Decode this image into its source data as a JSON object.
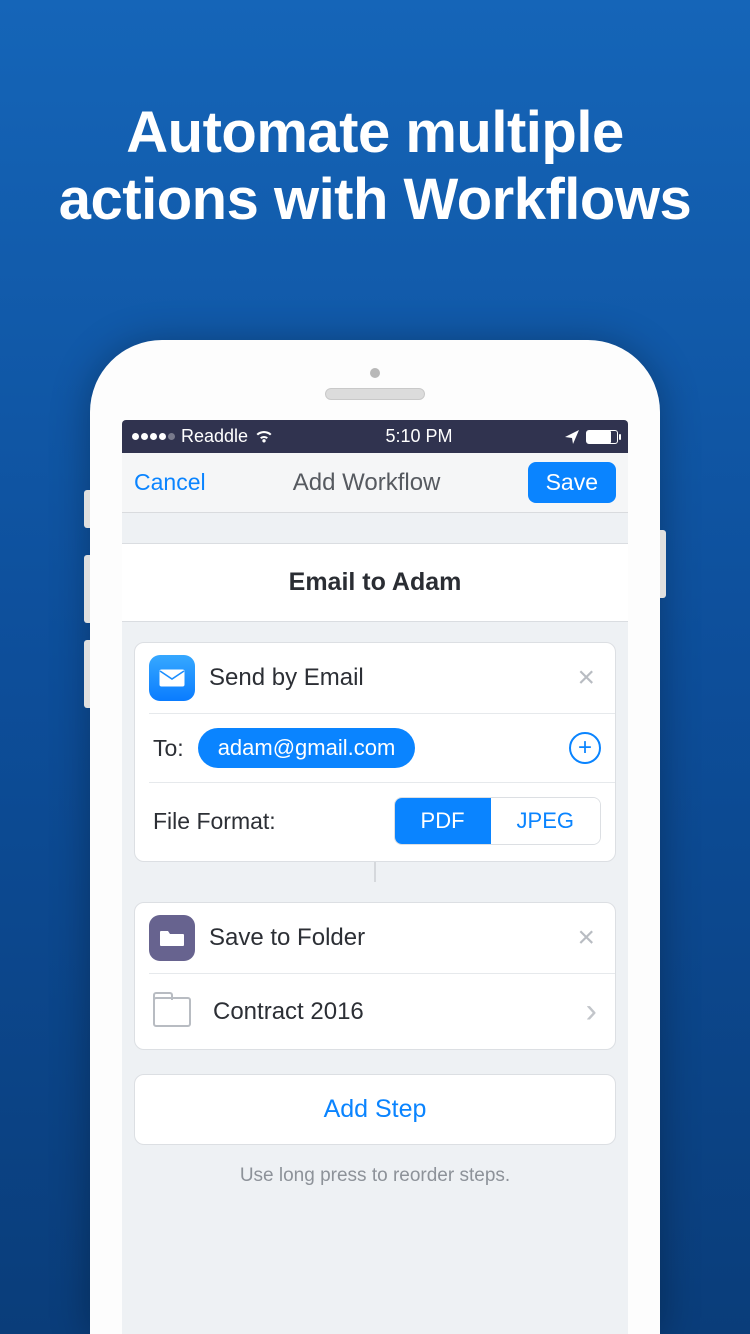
{
  "promo": {
    "title": "Automate multiple actions with Workflows"
  },
  "status": {
    "carrier": "Readdle",
    "time": "5:10 PM"
  },
  "nav": {
    "cancel": "Cancel",
    "title": "Add Workflow",
    "save": "Save"
  },
  "workflow": {
    "name": "Email to Adam",
    "steps": [
      {
        "label": "Send by Email",
        "to_label": "To:",
        "to_email": "adam@gmail.com",
        "format_label": "File Format:",
        "format_options": [
          "PDF",
          "JPEG"
        ],
        "format_selected": "PDF"
      },
      {
        "label": "Save to Folder",
        "folder": "Contract 2016"
      }
    ],
    "add_step_label": "Add Step",
    "hint": "Use long press to reorder steps."
  }
}
